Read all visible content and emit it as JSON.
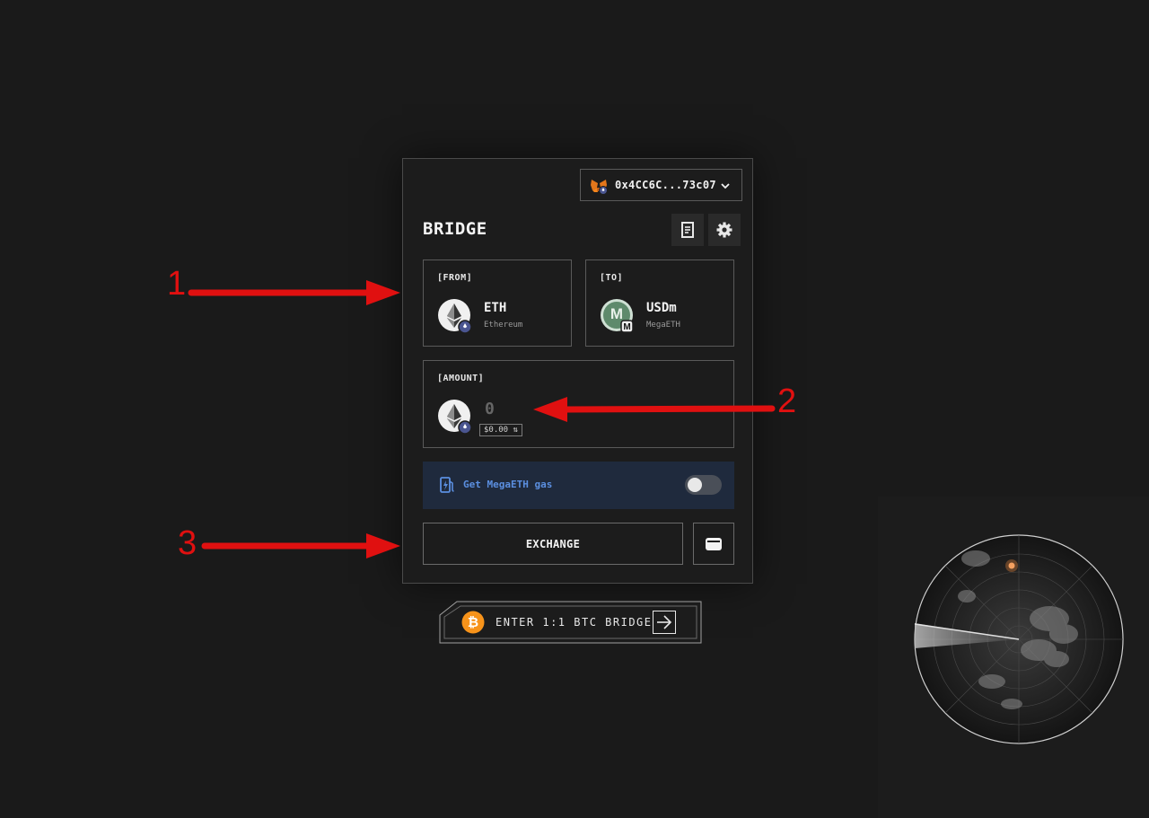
{
  "wallet": {
    "address": "0x4CC6C...73c07",
    "icon": "metamask-fox-icon"
  },
  "bridge": {
    "title": "BRIDGE",
    "history_icon": "receipt-icon",
    "settings_icon": "gear-icon",
    "from": {
      "label": "[FROM]",
      "symbol": "ETH",
      "network": "Ethereum",
      "icon": "eth-icon"
    },
    "to": {
      "label": "[TO]",
      "symbol": "USDm",
      "network": "MegaETH",
      "icon": "usdm-icon"
    },
    "amount": {
      "label": "[AMOUNT]",
      "value": "0",
      "usd": "$0.00 ⇅"
    },
    "gas": {
      "label": "Get MegaETH gas",
      "enabled": false
    },
    "exchange_label": "EXCHANGE"
  },
  "btc_bridge": {
    "label": "ENTER 1:1 BTC BRIDGE",
    "btc_symbol": "₿"
  },
  "annotations": [
    "1",
    "2",
    "3"
  ],
  "colors": {
    "background": "#1a1a1a",
    "accent_blue": "#5b8fe0",
    "annotation_red": "#e01010",
    "btc_orange": "#f7931a"
  }
}
